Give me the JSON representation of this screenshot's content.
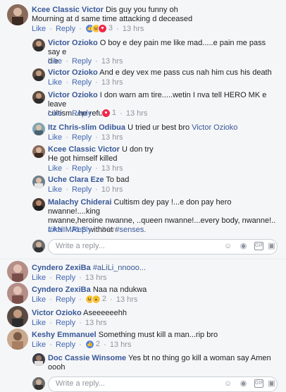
{
  "ui": {
    "like": "Like",
    "reply": "Reply",
    "dot": "·",
    "write_reply": "Write a reply..."
  },
  "comments": [
    {
      "name": "Kcee Classic Victor",
      "text": "Dis guy you funny oh",
      "text2": "Mourning at d same time attacking d deceased",
      "reactions": "3",
      "time": "13 hrs"
    },
    {
      "name": "Victor Ozioko",
      "text": "O boy e dey pain me like mad.....e pain me pass say e",
      "text2": "die",
      "time": "13 hrs"
    },
    {
      "name": "Victor Ozioko",
      "text": "And e dey vex me pass cus nah him cus his death",
      "time": "13 hrs"
    },
    {
      "name": "Victor Ozioko",
      "text": "I don warn am tire.....wetin I nva tell HERO MK e leave",
      "text2": "cultism...he refuse",
      "reactions": "1",
      "time": "13 hrs"
    },
    {
      "name": "Itz Chris-slim Odibua",
      "text": "U tried ur best bro",
      "mention": "Victor Ozioko",
      "time": "13 hrs"
    },
    {
      "name": "Kcee Classic Victor",
      "text": "U don try",
      "text2": "He got himself killed",
      "time": "13 hrs"
    },
    {
      "name": "Uche Clara Eze",
      "text": "To bad",
      "time": "10 hrs"
    },
    {
      "name": "Malachy Chiderai",
      "text": "Cultism dey pay !...e don pay hero nwanne!....king",
      "text2": "nwanne,heroine nwanne, ..queen nwanne!...every body, nwanne!..",
      "hash1": "#ANIMALS",
      "mid": " without ",
      "hash2": "#senses.",
      "time": "3 hrs"
    },
    {
      "name": "Cyndero ZexiBa",
      "text": "#aLiLi_nnooo...",
      "time": "13 hrs"
    },
    {
      "name": "Cyndero ZexiBa",
      "text": "Naa na ndukwa",
      "reactions": "2",
      "time": "13 hrs"
    },
    {
      "name": "Victor Ozioko",
      "text": "Aseeeeeehh",
      "time": "13 hrs"
    },
    {
      "name": "Keshy Emmanuel",
      "text": "Something must kill a man...rip bro",
      "reactions": "2",
      "time": "13 hrs"
    },
    {
      "name": "Doc Cassie Winsome",
      "text": "Yes bt no thing go kill a woman say Amen oooh"
    }
  ],
  "colors": {
    "link": "#385898",
    "meta": "#90949c",
    "bg": "#f5f6f7"
  },
  "icons": [
    "emoji-icon",
    "camera-icon",
    "gif-icon",
    "sticker-icon"
  ]
}
